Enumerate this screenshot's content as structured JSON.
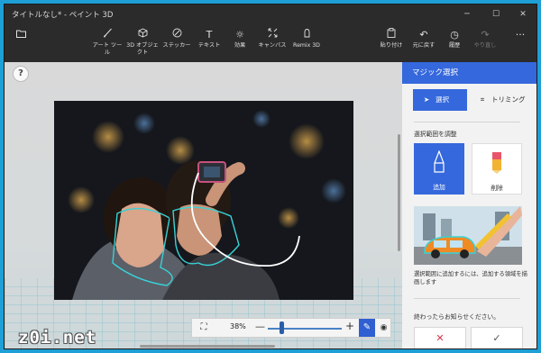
{
  "window": {
    "title": "タイトルなし* - ペイント 3D",
    "controls": {
      "minimize": "─",
      "maximize": "☐",
      "close": "✕"
    }
  },
  "toolbar": {
    "menu_icon": "folder-icon",
    "tools": [
      {
        "label": "アート ツール",
        "icon": "brush-icon"
      },
      {
        "label": "3D オブジェクト",
        "icon": "cube-icon"
      },
      {
        "label": "ステッカー",
        "icon": "sticker-icon"
      },
      {
        "label": "テキスト",
        "icon": "text-icon"
      },
      {
        "label": "効果",
        "icon": "sun-icon"
      },
      {
        "label": "キャンバス",
        "icon": "canvas-icon"
      },
      {
        "label": "Remix 3D",
        "icon": "remix-icon"
      }
    ],
    "right_tools": [
      {
        "label": "貼り付け",
        "icon": "paste-icon"
      },
      {
        "label": "元に戻す",
        "icon": "undo-icon"
      },
      {
        "label": "履歴",
        "icon": "history-icon"
      },
      {
        "label": "やり直し",
        "icon": "redo-icon"
      }
    ],
    "more": "···"
  },
  "canvas": {
    "help": "?"
  },
  "zoom": {
    "value": "38%",
    "level_fraction": 0.38,
    "minus": "—",
    "plus": "+"
  },
  "panel": {
    "title": "マジック選択",
    "modes": {
      "select": "選択",
      "trim": "トリミング"
    },
    "adjust_label": "選択範囲を調整",
    "add": "追加",
    "remove": "削除",
    "hint": "選択範囲に追加するには、追加する領域を描画します",
    "done_prompt": "終わったらお知らせください。",
    "cancel": "✕",
    "confirm": "✓"
  },
  "colors": {
    "accent": "#3568dc",
    "titlebar": "#2b2b2b",
    "desktop": "#1e9fd6"
  },
  "watermark": "z0i.net"
}
